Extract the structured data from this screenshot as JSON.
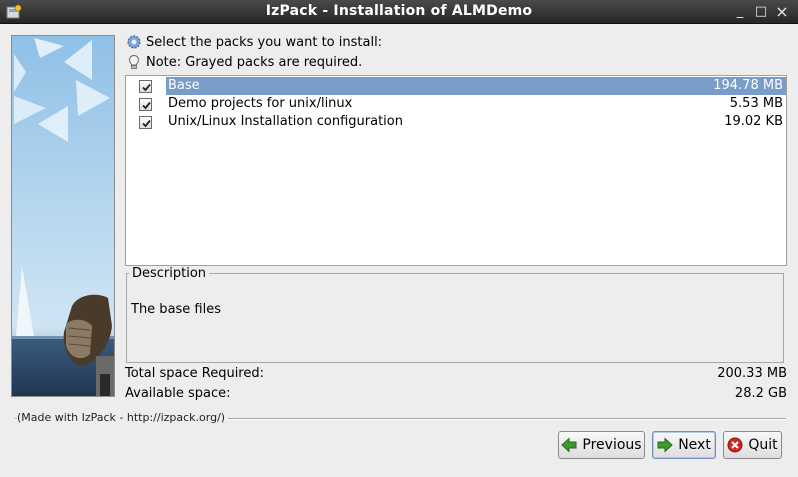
{
  "window": {
    "title": "IzPack - Installation of ALMDemo",
    "controls": {
      "minimize": "_",
      "maximize": "□",
      "close": "×"
    }
  },
  "header": {
    "instruction": "Select the packs you want to install:",
    "note": "Note: Grayed packs are required."
  },
  "packs": [
    {
      "name": "Base",
      "size": "194.78 MB",
      "checked": true,
      "selected": true
    },
    {
      "name": "Demo projects for unix/linux",
      "size": "5.53 MB",
      "checked": true,
      "selected": false
    },
    {
      "name": "Unix/Linux Installation configuration",
      "size": "19.02 KB",
      "checked": true,
      "selected": false
    }
  ],
  "description": {
    "legend": "Description",
    "text": "The base files"
  },
  "space": {
    "required_label": "Total space Required:",
    "required_value": "200.33 MB",
    "available_label": "Available space:",
    "available_value": "28.2 GB"
  },
  "footer": {
    "made_with": "(Made with IzPack - http://izpack.org/)"
  },
  "buttons": {
    "previous": "Previous",
    "next": "Next",
    "quit": "Quit"
  },
  "colors": {
    "selection": "#7a9cc8",
    "titlebar": "#333333",
    "arrow_green": "#3c9a2e",
    "quit_red": "#d0281e"
  },
  "icons": {
    "instruction": "gear-icon",
    "note": "lightbulb-icon",
    "previous": "arrow-left-icon",
    "next": "arrow-right-icon",
    "quit": "stop-icon"
  }
}
